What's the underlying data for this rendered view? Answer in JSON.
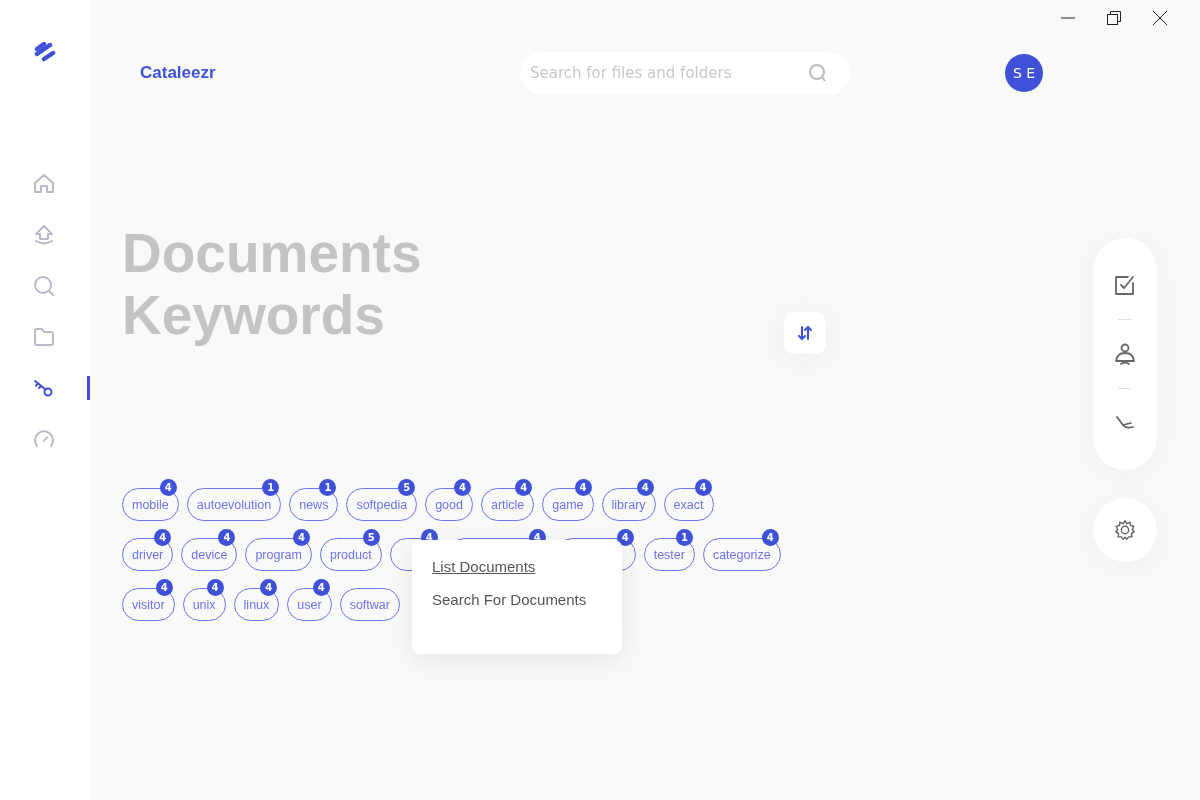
{
  "brand": "Cataleezr",
  "search": {
    "placeholder": "Search for files and folders"
  },
  "avatar": "S E",
  "nav": [
    {
      "kind": "home",
      "selected": false
    },
    {
      "kind": "upload",
      "selected": false
    },
    {
      "kind": "search",
      "selected": false
    },
    {
      "kind": "folder",
      "selected": false
    },
    {
      "kind": "key",
      "selected": true
    },
    {
      "kind": "gauge",
      "selected": false
    }
  ],
  "title": [
    "Documents",
    "Keywords"
  ],
  "tag_rows": [
    [
      {
        "label": "mobile",
        "count": "4"
      },
      {
        "label": "autoevolution",
        "count": "1"
      },
      {
        "label": "news",
        "count": "1"
      },
      {
        "label": "softpedia",
        "count": "5"
      },
      {
        "label": "good",
        "count": "4"
      },
      {
        "label": "article",
        "count": "4"
      },
      {
        "label": "game",
        "count": "4"
      },
      {
        "label": "library",
        "count": "4"
      },
      {
        "label": "exact",
        "count": "4"
      }
    ],
    [
      {
        "label": "driver",
        "count": "4"
      },
      {
        "label": "device",
        "count": "4"
      },
      {
        "label": "program",
        "count": "4"
      },
      {
        "label": "product",
        "count": "5"
      },
      {
        "count": "4"
      },
      {
        "count": "4"
      },
      {
        "count": "4"
      },
      {
        "label": "tester",
        "count": "1"
      },
      {
        "label": "categorize",
        "count": "4"
      }
    ],
    [
      {
        "label": "visitor",
        "count": "4"
      },
      {
        "label": "unix",
        "count": "4"
      },
      {
        "label": "linux",
        "count": "4"
      },
      {
        "label": "user",
        "count": "4"
      },
      {
        "label": "softwar"
      }
    ]
  ],
  "menu": [
    {
      "label": "List Documents",
      "selected": true
    },
    {
      "label": "Search For Documents",
      "selected": false
    }
  ],
  "rail": [
    {
      "kind": "checklist"
    },
    {
      "kind": "person"
    },
    {
      "kind": "brush"
    }
  ]
}
